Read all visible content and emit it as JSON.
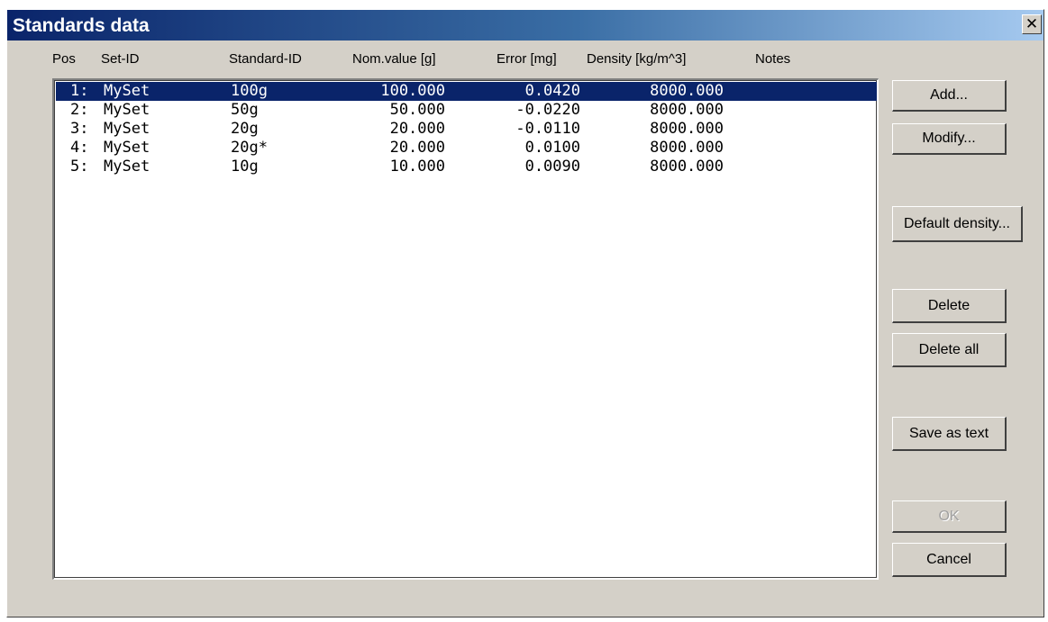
{
  "window": {
    "title": "Standards data",
    "close_glyph": "✕"
  },
  "columns": {
    "pos": "Pos",
    "set_id": "Set-ID",
    "standard_id": "Standard-ID",
    "nom_value": "Nom.value [g]",
    "error": "Error [mg]",
    "density": "Density [kg/m^3]",
    "notes": "Notes"
  },
  "rows": [
    {
      "pos": "1:",
      "set_id": "MySet",
      "standard_id": "100g",
      "nom_value": "100.000",
      "error": "0.0420",
      "density": "8000.000",
      "notes": "",
      "selected": true
    },
    {
      "pos": "2:",
      "set_id": "MySet",
      "standard_id": "50g",
      "nom_value": "50.000",
      "error": "-0.0220",
      "density": "8000.000",
      "notes": "",
      "selected": false
    },
    {
      "pos": "3:",
      "set_id": "MySet",
      "standard_id": "20g",
      "nom_value": "20.000",
      "error": "-0.0110",
      "density": "8000.000",
      "notes": "",
      "selected": false
    },
    {
      "pos": "4:",
      "set_id": "MySet",
      "standard_id": "20g*",
      "nom_value": "20.000",
      "error": "0.0100",
      "density": "8000.000",
      "notes": "",
      "selected": false
    },
    {
      "pos": "5:",
      "set_id": "MySet",
      "standard_id": "10g",
      "nom_value": "10.000",
      "error": "0.0090",
      "density": "8000.000",
      "notes": "",
      "selected": false
    }
  ],
  "buttons": {
    "add": "Add...",
    "modify": "Modify...",
    "default_density": "Default density...",
    "delete": "Delete",
    "delete_all": "Delete all",
    "save_as_text": "Save as text",
    "ok": "OK",
    "cancel": "Cancel"
  },
  "colors": {
    "titlebar_start": "#0a246a",
    "titlebar_end": "#a6caf0",
    "selection": "#0a246a",
    "dialog_face": "#d4d0c8"
  }
}
